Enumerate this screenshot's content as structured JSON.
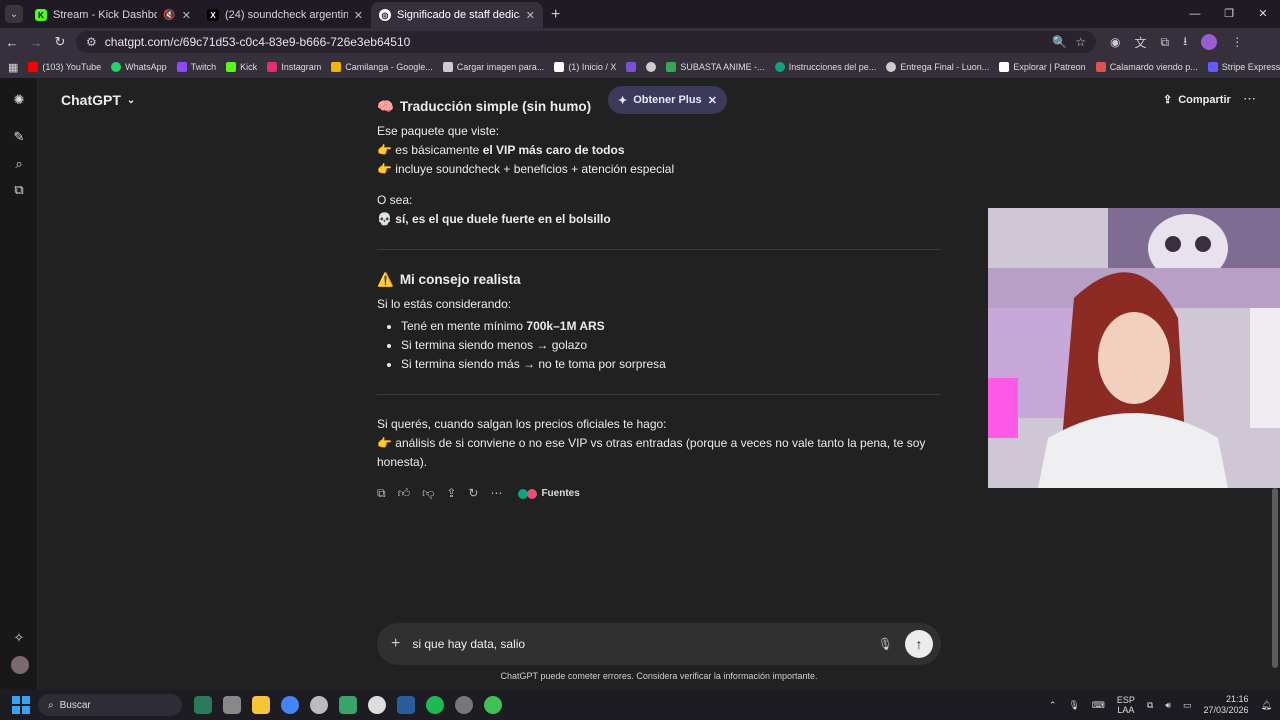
{
  "browser": {
    "tabs": [
      {
        "title": "Stream - Kick Dashboard",
        "favicon": "kick-icon"
      },
      {
        "title": "(24) soundcheck argentina - Bu",
        "favicon": "x-icon"
      },
      {
        "title": "Significado de staff dedicado",
        "favicon": "chatgpt-icon",
        "active": true
      }
    ],
    "url": "chatgpt.com/c/69c71d53-c0c4-83e9-b666-726e3eb64510",
    "bookmarks": [
      {
        "label": "(103) YouTube",
        "color": "#ff0000"
      },
      {
        "label": "WhatsApp",
        "color": "#25d366"
      },
      {
        "label": "Twitch",
        "color": "#9146ff"
      },
      {
        "label": "Kick",
        "color": "#53fc18"
      },
      {
        "label": "Instagram",
        "color": "#e1306c"
      },
      {
        "label": "Camilanga - Google...",
        "color": "#f4b400"
      },
      {
        "label": "Cargar imagen para...",
        "color": "#cccccc"
      },
      {
        "label": "(1) Inicio / X",
        "color": "#ffffff"
      },
      {
        "label": "",
        "color": "#7b4fd6"
      },
      {
        "label": "",
        "color": "#cccccc"
      },
      {
        "label": "SUBASTA ANIME -...",
        "color": "#34a853"
      },
      {
        "label": "Instrucciones del pe...",
        "color": "#10a37f"
      },
      {
        "label": "Entrega Final - Luon...",
        "color": "#cccccc"
      },
      {
        "label": "Explorar | Patreon",
        "color": "#ffffff"
      },
      {
        "label": "Calamardo viendo p...",
        "color": "#d9534f"
      },
      {
        "label": "Stripe Express",
        "color": "#635bff"
      }
    ]
  },
  "header": {
    "model": "ChatGPT",
    "plus_label": "Obtener Plus",
    "share_label": "Compartir"
  },
  "message": {
    "section1": {
      "emoji": "🧠",
      "title": "Traducción simple (sin humo)",
      "intro": "Ese paquete que viste:",
      "line1_prefix": "es básicamente ",
      "line1_bold": "el VIP más caro de todos",
      "line2": "incluye soundcheck + beneficios + atención especial",
      "o_sea": "O sea:",
      "conclusion": "sí, es el que duele fuerte en el bolsillo"
    },
    "section2": {
      "emoji": "⚠️",
      "title": "Mi consejo realista",
      "intro": "Si lo estás considerando:",
      "b1_prefix": "Tené en mente mínimo ",
      "b1_bold": "700k–1M ARS",
      "b2": "Si termina siendo menos → golazo",
      "b3": "Si termina siendo más → no te toma por sorpresa"
    },
    "section3": {
      "intro": "Si querés, cuando salgan los precios oficiales te hago:",
      "body": "análisis de si conviene o no ese VIP vs otras entradas (porque a veces no vale tanto la pena, te soy honesta)."
    },
    "sources_label": "Fuentes"
  },
  "composer": {
    "value": "si que hay data, salio",
    "disclaimer": "ChatGPT puede cometer errores. Considera verificar la información importante."
  },
  "taskbar": {
    "search_label": "Buscar",
    "lang_line1": "ESP",
    "lang_line2": "LAA",
    "time": "21:16",
    "date": "27/03/2026"
  }
}
